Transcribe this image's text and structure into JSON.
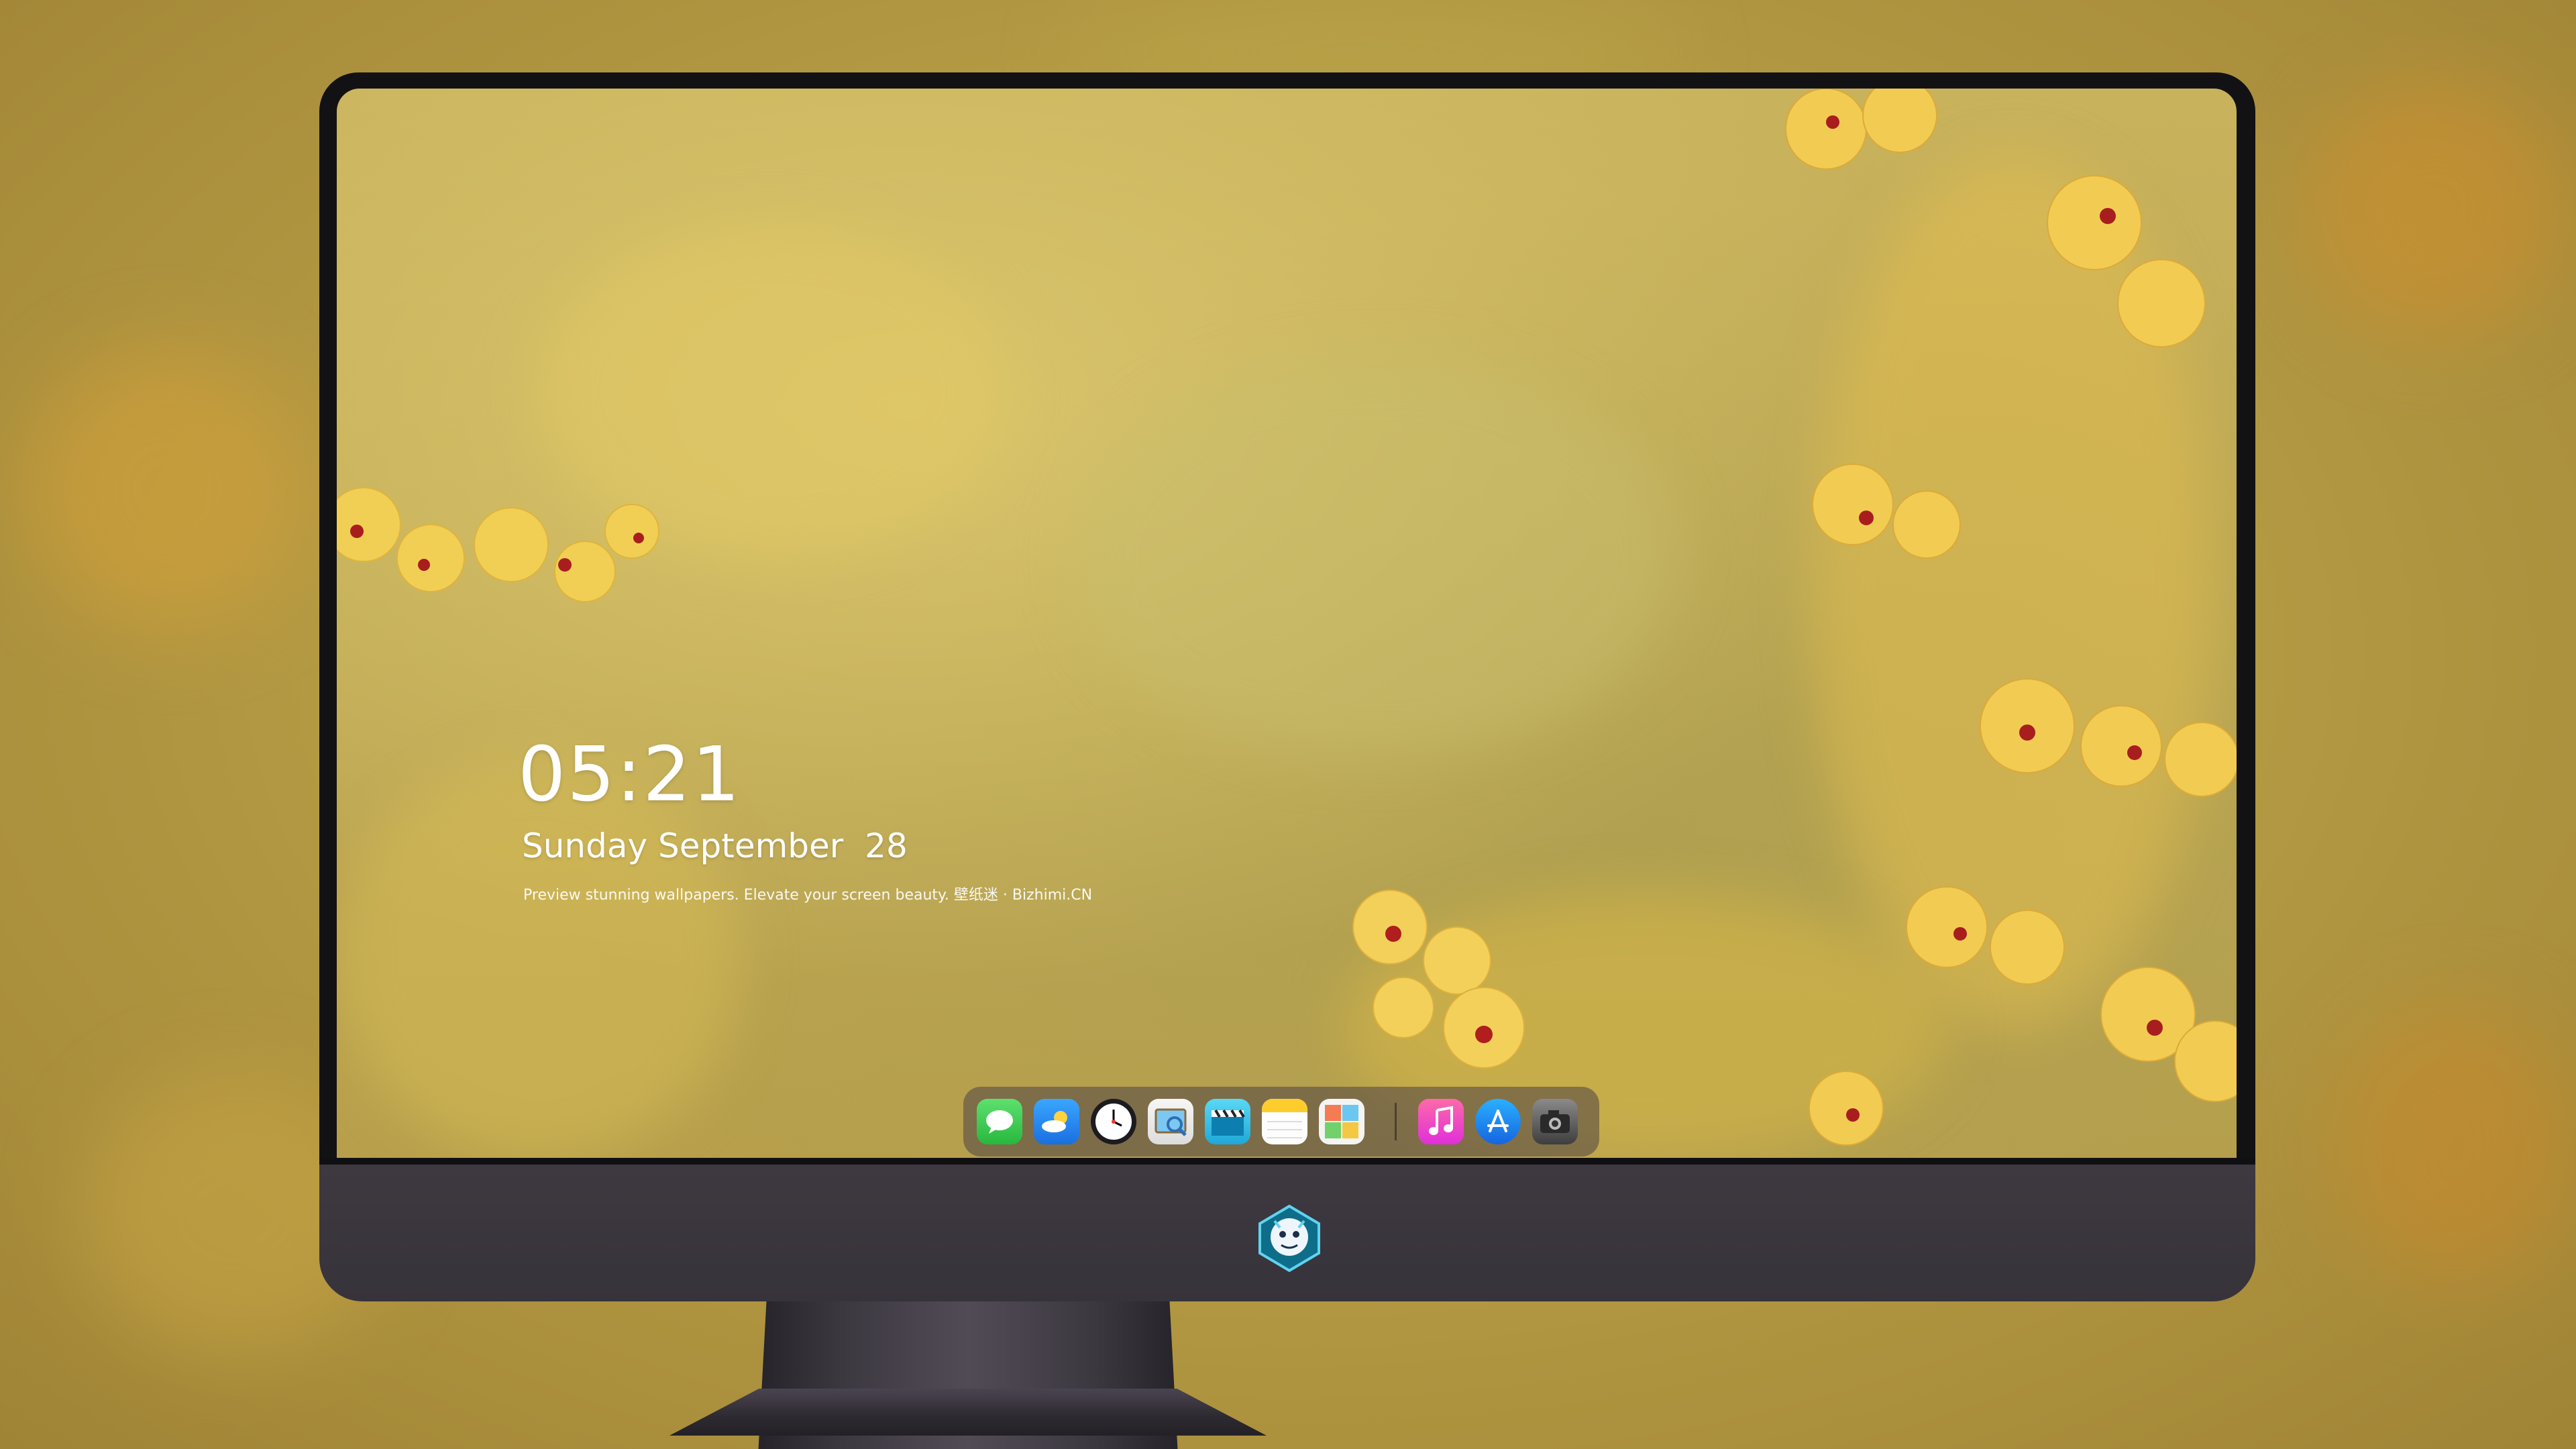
{
  "lockscreen": {
    "time": "05:21",
    "date": "Sunday September  28",
    "caption": "Preview stunning wallpapers. Elevate your screen beauty. 壁纸迷 · Bizhimi.CN"
  },
  "dock": {
    "apps": [
      {
        "name": "messages-icon",
        "color": "#34c759"
      },
      {
        "name": "weather-icon",
        "color": "#1e90ff"
      },
      {
        "name": "clock-icon",
        "color": "#1c1c1e"
      },
      {
        "name": "preview-icon",
        "color": "#f2f2f2"
      },
      {
        "name": "final-cut-icon",
        "color": "#35c6e8"
      },
      {
        "name": "notes-icon",
        "color": "#ffd43b"
      },
      {
        "name": "photo-booth-icon",
        "color": "#f4f4f4"
      },
      {
        "name": "music-icon",
        "color": "#fc5c9c"
      },
      {
        "name": "app-store-icon",
        "color": "#1a8cff"
      },
      {
        "name": "camera-icon",
        "color": "#4a4a4a"
      }
    ]
  },
  "monitor": {
    "logo": "dragon-mascot-logo"
  },
  "colors": {
    "wallpaper": "#c2ac57",
    "bezel": "#121215",
    "chin": "#3b363d",
    "dock": "#5a4e46"
  }
}
